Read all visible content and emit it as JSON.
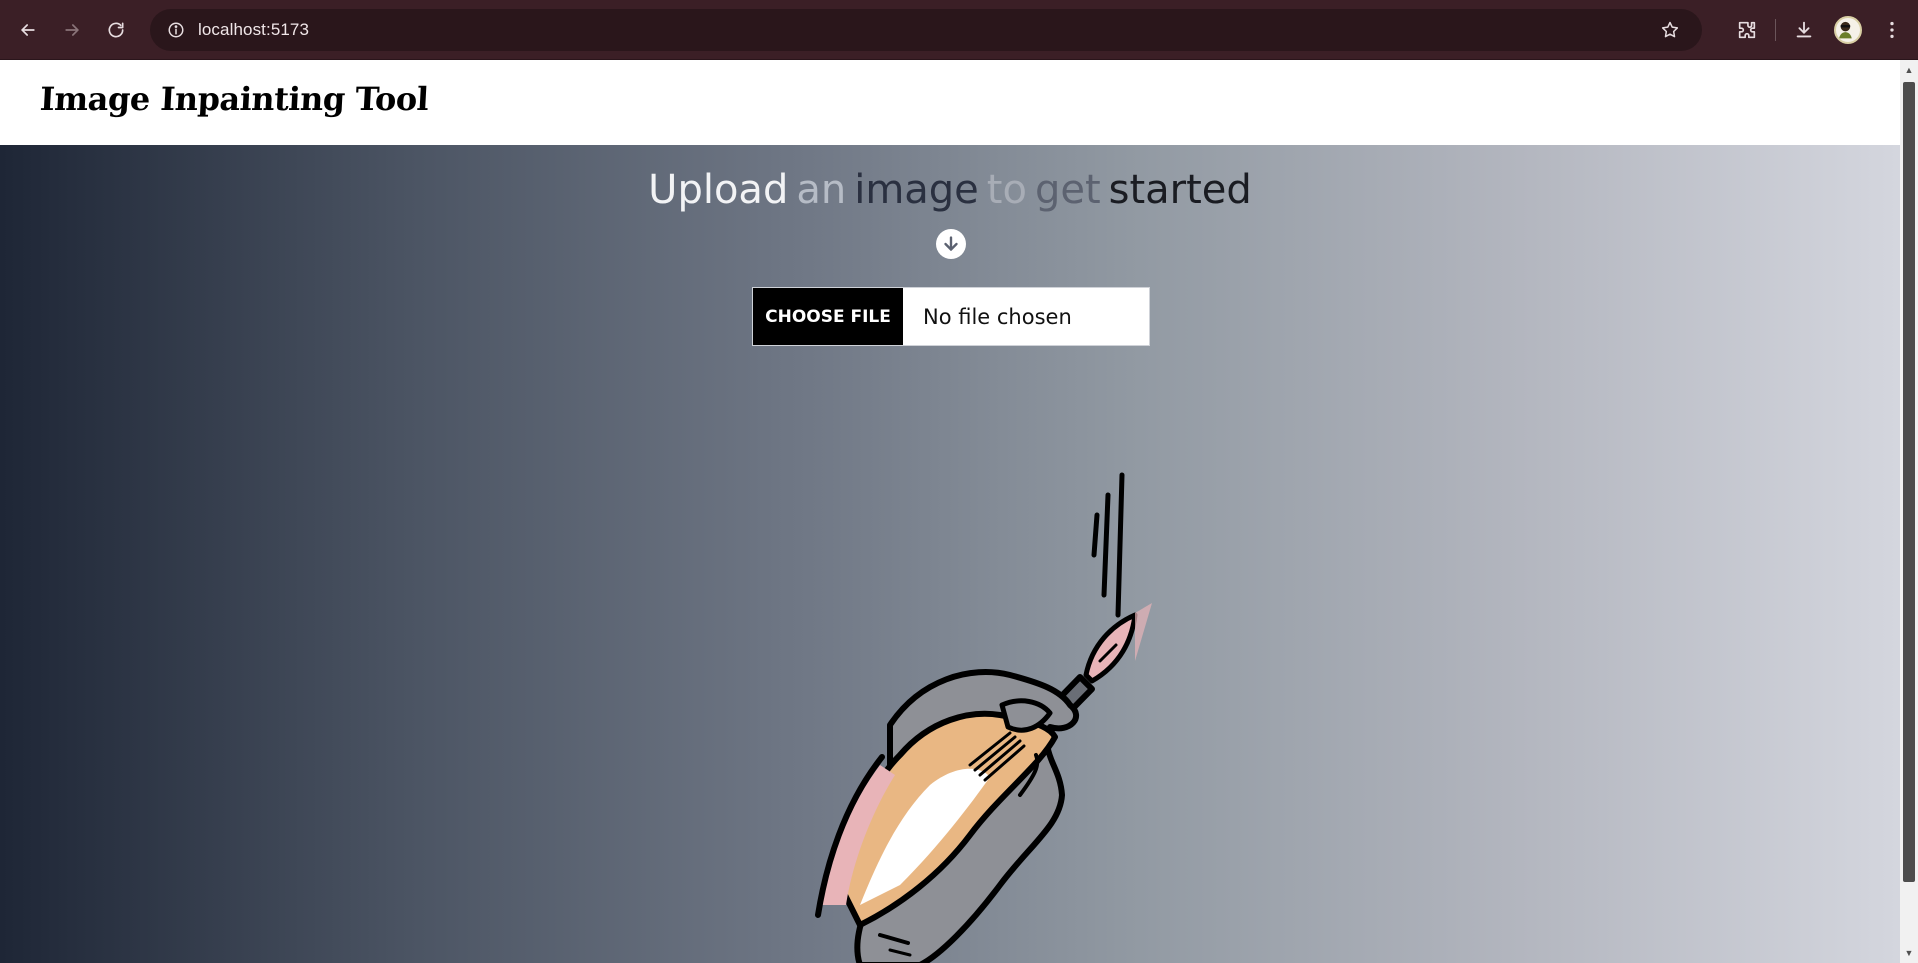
{
  "browser": {
    "url": "localhost:5173",
    "nav": {
      "back_icon": "arrow-left-icon",
      "forward_icon": "arrow-right-icon",
      "reload_icon": "reload-icon"
    },
    "toolbar_icons": [
      "star-icon",
      "extensions-icon",
      "download-icon",
      "profile-avatar",
      "more-vert-icon"
    ]
  },
  "app": {
    "title": "Image Inpainting Tool"
  },
  "hero": {
    "heading_words": [
      {
        "text": "Upload",
        "color": "#f2f3f5"
      },
      {
        "text": "an",
        "color": "#b6bcc6"
      },
      {
        "text": "image",
        "color": "#2a3040"
      },
      {
        "text": "to",
        "color": "#a8adb6"
      },
      {
        "text": "get",
        "color": "#5c6270"
      },
      {
        "text": "started",
        "color": "#1a1c22"
      }
    ],
    "arrow_icon": "arrow-down-circle-icon"
  },
  "file_input": {
    "button_label": "CHOOSE FILE",
    "status": "No file chosen"
  },
  "colors": {
    "browser_bar": "#3b1f26",
    "gradient_start": "#1e2636",
    "gradient_end": "#d4d6de",
    "button_bg": "#000000"
  }
}
